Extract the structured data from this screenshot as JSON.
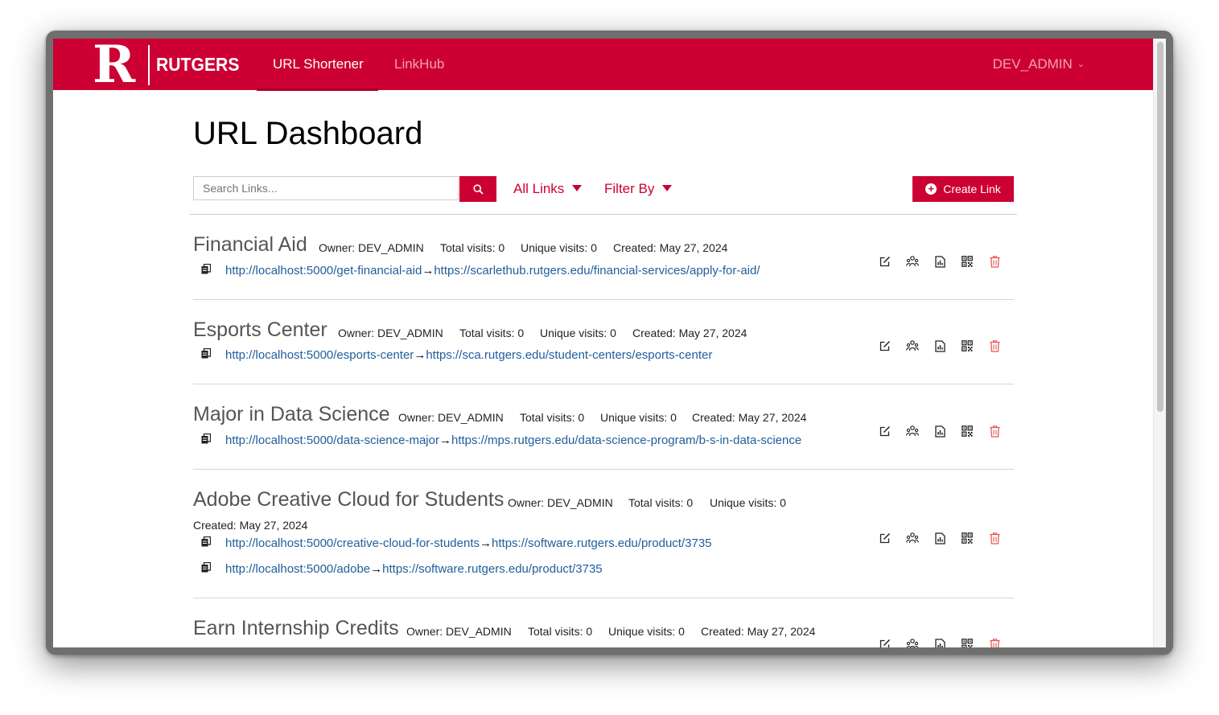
{
  "brand": {
    "initial": "R",
    "wordmark": "RUTGERS"
  },
  "nav": {
    "tabs": [
      "URL Shortener",
      "LinkHub"
    ],
    "user": "DEV_ADMIN"
  },
  "page": {
    "title": "URL Dashboard"
  },
  "toolbar": {
    "search_placeholder": "Search Links...",
    "all_links": "All Links",
    "filter_by": "Filter By",
    "create": "Create Link"
  },
  "links": [
    {
      "title": "Financial Aid",
      "owner": "Owner: DEV_ADMIN",
      "total": "Total visits: 0",
      "unique": "Unique visits: 0",
      "created": "Created: May 27, 2024",
      "aliases": [
        {
          "short": "http://localhost:5000/get-financial-aid",
          "target": "https://scarlethub.rutgers.edu/financial-services/apply-for-aid/"
        }
      ]
    },
    {
      "title": "Esports Center",
      "owner": "Owner: DEV_ADMIN",
      "total": "Total visits: 0",
      "unique": "Unique visits: 0",
      "created": "Created: May 27, 2024",
      "aliases": [
        {
          "short": "http://localhost:5000/esports-center",
          "target": "https://sca.rutgers.edu/student-centers/esports-center"
        }
      ]
    },
    {
      "title": "Major in Data Science",
      "owner": "Owner: DEV_ADMIN",
      "total": "Total visits: 0",
      "unique": "Unique visits: 0",
      "created": "Created: May 27, 2024",
      "aliases": [
        {
          "short": "http://localhost:5000/data-science-major",
          "target": "https://mps.rutgers.edu/data-science-program/b-s-in-data-science"
        }
      ]
    },
    {
      "title": "Adobe Creative Cloud for Students",
      "owner": "Owner: DEV_ADMIN",
      "total": "Total visits: 0",
      "unique": "Unique visits: 0",
      "created": "Created: May 27, 2024",
      "aliases": [
        {
          "short": "http://localhost:5000/creative-cloud-for-students",
          "target": "https://software.rutgers.edu/product/3735"
        },
        {
          "short": "http://localhost:5000/adobe",
          "target": "https://software.rutgers.edu/product/3735"
        }
      ]
    },
    {
      "title": "Earn Internship Credits",
      "owner": "Owner: DEV_ADMIN",
      "total": "Total visits: 0",
      "unique": "Unique visits: 0",
      "created": "Created: May 27, 2024",
      "aliases": []
    }
  ],
  "arrow": "→",
  "colors": {
    "brand": "#cc0033",
    "link": "#1f5e9c",
    "delete": "#e8574e"
  }
}
